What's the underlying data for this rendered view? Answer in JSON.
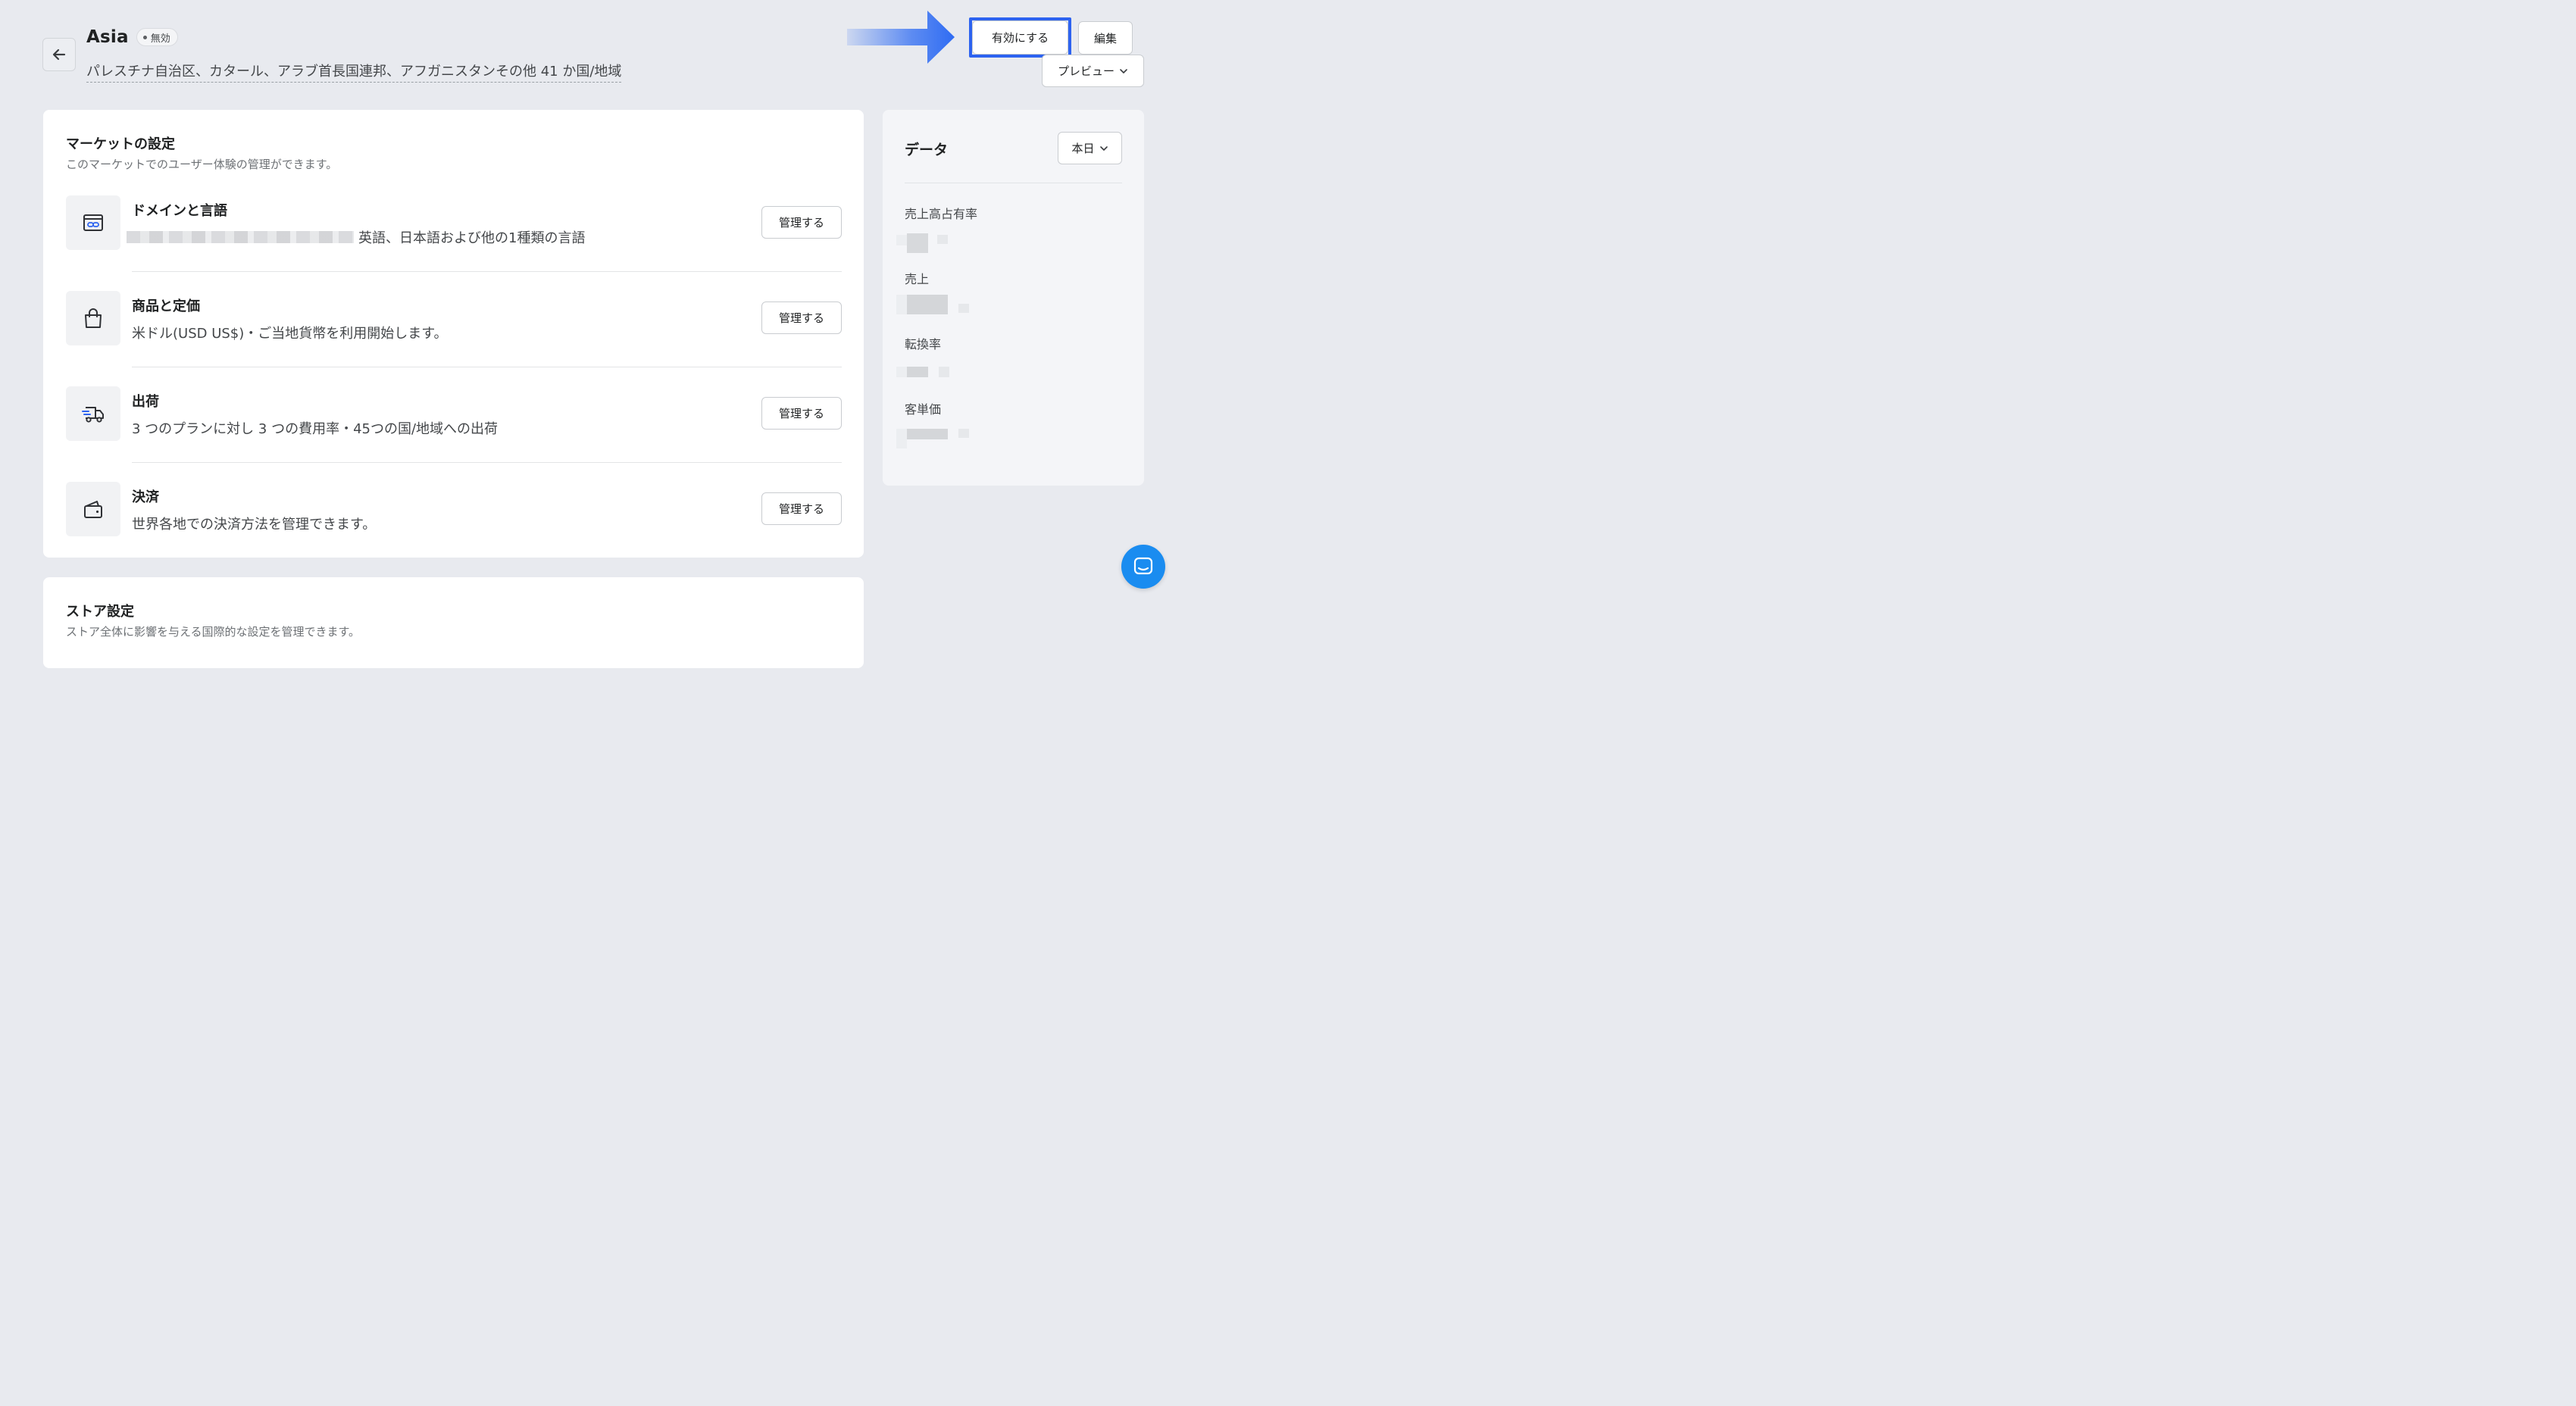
{
  "header": {
    "title": "Asia",
    "status_badge": "無効",
    "subtitle": "パレスチナ自治区、カタール、アラブ首長国連邦、アフガニスタンその他 41 か国/地域",
    "actions": {
      "activate_label": "有効にする",
      "edit_label": "編集",
      "preview_label": "プレビュー"
    }
  },
  "market_settings": {
    "title": "マーケットの設定",
    "description": "このマーケットでのユーザー体験の管理ができます。",
    "items": [
      {
        "title": "ドメインと言語",
        "description": "英語、日本語および他の1種類の言語",
        "button_label": "管理する",
        "icon": "domain-icon"
      },
      {
        "title": "商品と定価",
        "description": "米ドル(USD US$)・ご当地貨幣を利用開始します。",
        "button_label": "管理する",
        "icon": "shopping-bag-icon"
      },
      {
        "title": "出荷",
        "description": "3 つのプランに対し 3 つの費用率・45つの国/地域への出荷",
        "button_label": "管理する",
        "icon": "shipping-truck-icon"
      },
      {
        "title": "決済",
        "description": "世界各地での決済方法を管理できます。",
        "button_label": "管理する",
        "icon": "wallet-icon"
      }
    ]
  },
  "store_settings": {
    "title": "ストア設定",
    "description": "ストア全体に影響を与える国際的な設定を管理できます。"
  },
  "data_panel": {
    "title": "データ",
    "period_label": "本日",
    "metrics": [
      {
        "label": "売上高占有率"
      },
      {
        "label": "売上"
      },
      {
        "label": "転換率"
      },
      {
        "label": "客単価"
      }
    ]
  },
  "colors": {
    "highlight_border": "#2d63f0",
    "arrow": "#2f6cf3",
    "chat": "#1a8cf0"
  }
}
